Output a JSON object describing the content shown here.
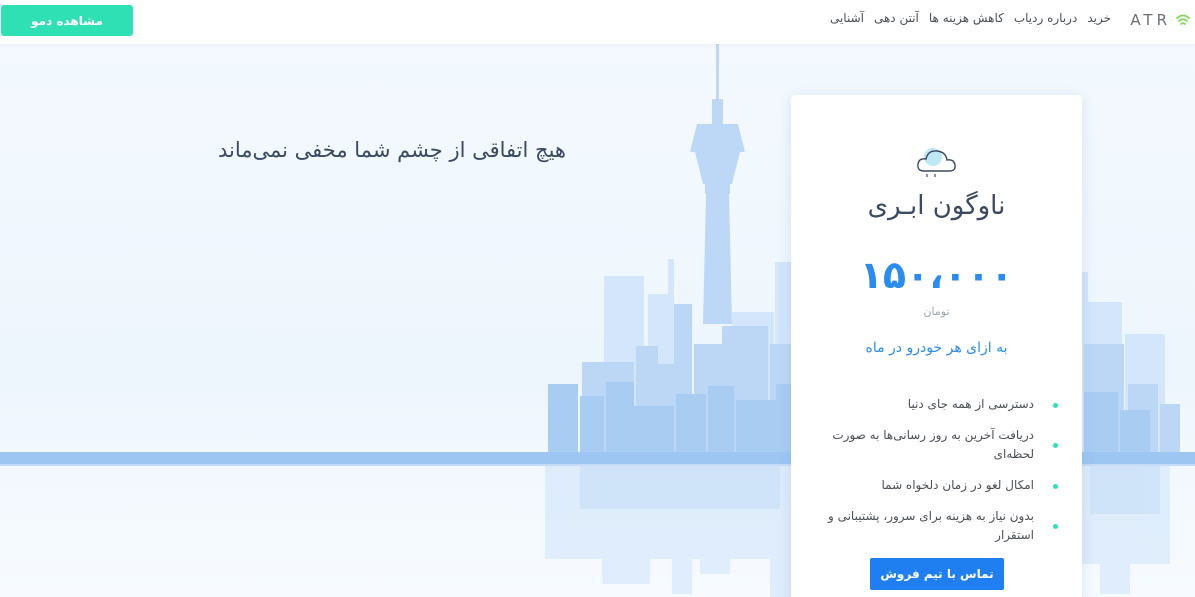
{
  "header": {
    "demo_button": "مشاهده دمو",
    "logo_text": "ATR",
    "nav": [
      "آشنایی",
      "آنتن دهی",
      "کاهش هزینه ها",
      "درباره ردیاب",
      "خرید"
    ]
  },
  "hero": {
    "title": "هیچ اتفاقی از چشم شما مخفی نمی‌ماند"
  },
  "plan": {
    "icon": "cloud-icon",
    "name": "ناوگون ابـری",
    "price": "۱۵۰،۰۰۰",
    "currency": "تومان",
    "per": "به ازای هر خودرو در ماه",
    "features": [
      "دسترسی از همه جای دنیا",
      "دریافت آخرین به روز رسانی‌ها به صورت لحظه‌ای",
      "امکال لغو در زمان دلخواه شما",
      "بدون نیاز به هزینه برای سرور، پشتیبانی و استقرار"
    ],
    "contact_button": "تماس با تیم فروش"
  },
  "colors": {
    "accent_green": "#2ee0b4",
    "accent_blue": "#2a8cf0",
    "button_blue": "#1f7ff0",
    "title_dark": "#3b4a63"
  }
}
